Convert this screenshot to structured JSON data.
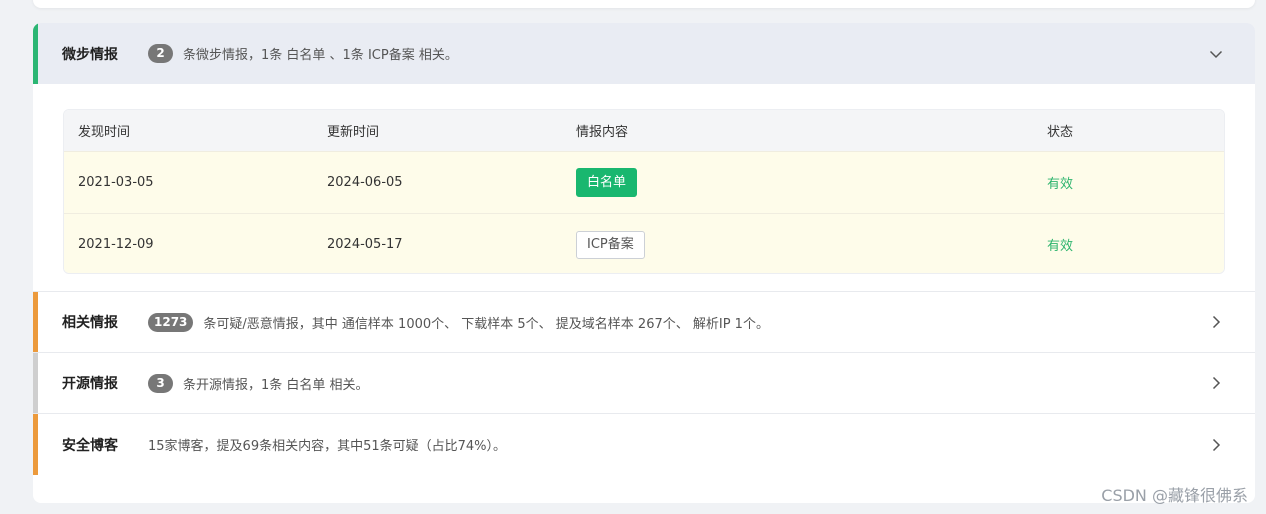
{
  "colors": {
    "accent_green": "#2bb673",
    "accent_orange": "#ec9a3c",
    "accent_gray": "#cfcfcf",
    "tag_green": "#19b76f",
    "status_valid": "#2db46d",
    "row_highlight": "#fefcea"
  },
  "weibu": {
    "title": "微步情报",
    "count": "2",
    "summary": "条微步情报，1条 白名单 、1条 ICP备案 相关。",
    "chevron": "chevron-down-icon",
    "table": {
      "headers": [
        "发现时间",
        "更新时间",
        "情报内容",
        "状态"
      ],
      "rows": [
        {
          "found": "2021-03-05",
          "updated": "2024-06-05",
          "content": "白名单",
          "status": "有效"
        },
        {
          "found": "2021-12-09",
          "updated": "2024-05-17",
          "content": "ICP备案",
          "status": "有效"
        }
      ]
    }
  },
  "related": {
    "title": "相关情报",
    "count": "1273",
    "summary": "条可疑/恶意情报，其中 通信样本 1000个、 下载样本 5个、 提及域名样本 267个、 解析IP 1个。",
    "chevron": "chevron-right-icon"
  },
  "opensource": {
    "title": "开源情报",
    "count": "3",
    "summary": "条开源情报，1条 白名单 相关。",
    "chevron": "chevron-right-icon"
  },
  "blogs": {
    "title": "安全博客",
    "summary": "15家博客，提及69条相关内容，其中51条可疑（占比74%）。",
    "chevron": "chevron-right-icon"
  },
  "watermark": "CSDN @藏锋很佛系"
}
